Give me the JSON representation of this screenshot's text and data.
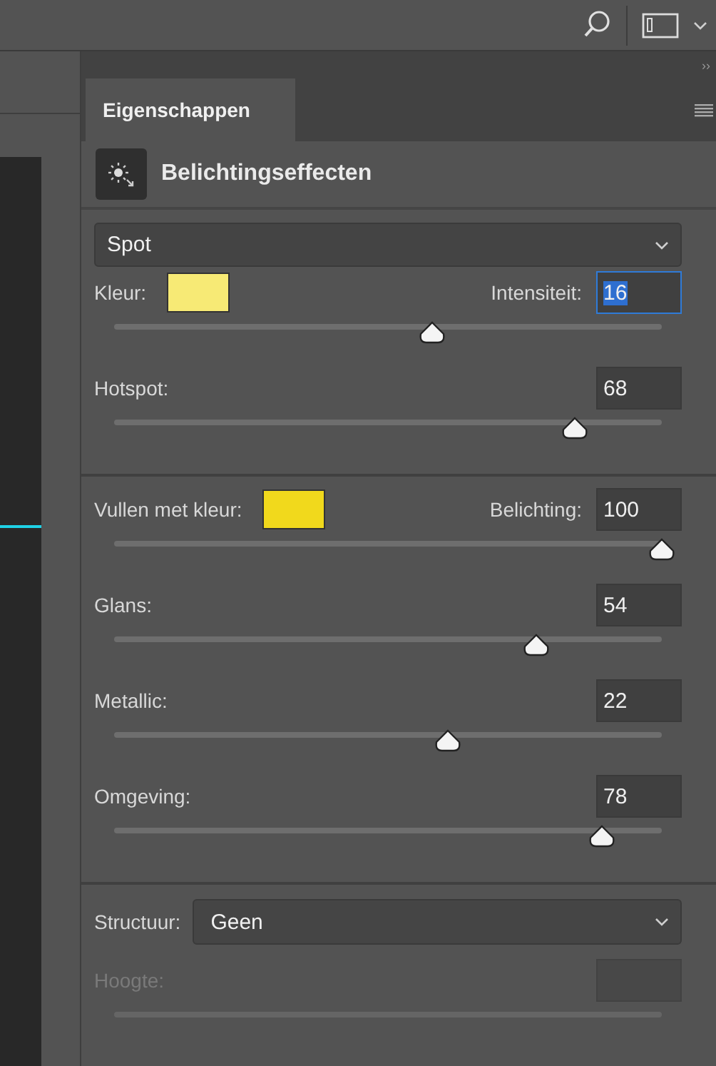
{
  "panel": {
    "collapse_glyph": "››",
    "tabs": [
      {
        "label": "Eigenschappen",
        "selected": true
      }
    ],
    "title": "Belichtingseffecten",
    "preset": "Spot"
  },
  "sections": [
    {
      "params": [
        {
          "kind": "swatch",
          "label": "Kleur:",
          "color": "#f7ea75",
          "value_label": "Intensiteit:",
          "value": "16",
          "focused": true,
          "level": 0.58,
          "disabled": false
        },
        {
          "kind": "plain",
          "label": "Hotspot:",
          "value": "68",
          "focused": false,
          "level": 0.84,
          "disabled": false
        }
      ]
    },
    {
      "params": [
        {
          "kind": "swatch",
          "label": "Vullen met kleur:",
          "color": "#f1d91c",
          "value_label": "Belichting:",
          "value": "100",
          "focused": false,
          "level": 1.0,
          "disabled": false
        },
        {
          "kind": "plain",
          "label": "Glans:",
          "value": "54",
          "focused": false,
          "level": 0.77,
          "disabled": false
        },
        {
          "kind": "plain",
          "label": "Metallic:",
          "value": "22",
          "focused": false,
          "level": 0.61,
          "disabled": false
        },
        {
          "kind": "plain",
          "label": "Omgeving:",
          "value": "78",
          "focused": false,
          "level": 0.89,
          "disabled": false
        }
      ]
    },
    {
      "structure": {
        "label": "Structuur:",
        "value": "Geen"
      },
      "params": [
        {
          "kind": "plain",
          "label": "Hoogte:",
          "disabled": true
        }
      ]
    }
  ]
}
